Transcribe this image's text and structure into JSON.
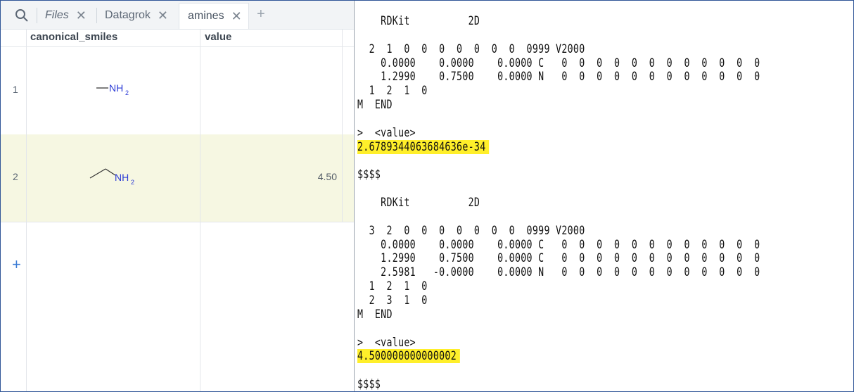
{
  "tabs": [
    {
      "label": "Files",
      "italic": true
    },
    {
      "label": "Datagrok",
      "italic": false
    },
    {
      "label": "amines",
      "italic": false,
      "active": true
    }
  ],
  "grid": {
    "columns": [
      "canonical_smiles",
      "value"
    ],
    "rows": [
      {
        "num": "1",
        "molecule": "methylamine",
        "atom_label": "NH",
        "atom_sub": "2",
        "value": ""
      },
      {
        "num": "2",
        "molecule": "ethylamine",
        "atom_label": "NH",
        "atom_sub": "2",
        "value": "4.50"
      }
    ]
  },
  "sdf": {
    "lines": [
      "    RDKit          2D",
      "",
      "  2  1  0  0  0  0  0  0  0  0999 V2000",
      "    0.0000    0.0000    0.0000 C   0  0  0  0  0  0  0  0  0  0  0  0",
      "    1.2990    0.7500    0.0000 N   0  0  0  0  0  0  0  0  0  0  0  0",
      "  1  2  1  0",
      "M  END",
      "",
      ">  <value>",
      "2.6789344063684636e-34",
      "",
      "$$$$",
      "",
      "    RDKit          2D",
      "",
      "  3  2  0  0  0  0  0  0  0  0999 V2000",
      "    0.0000    0.0000    0.0000 C   0  0  0  0  0  0  0  0  0  0  0  0",
      "    1.2990    0.7500    0.0000 C   0  0  0  0  0  0  0  0  0  0  0  0",
      "    2.5981   -0.0000    0.0000 N   0  0  0  0  0  0  0  0  0  0  0  0",
      "  1  2  1  0",
      "  2  3  1  0",
      "M  END",
      "",
      ">  <value>",
      "4.500000000000002",
      "",
      "$$$$"
    ],
    "highlighted_line_indices": [
      9,
      24
    ]
  },
  "colors": {
    "highlight": "#ffef2a",
    "selected_row": "#f6f7e2",
    "nitrogen": "#2b3bd6",
    "accent": "#3a7bd5"
  }
}
